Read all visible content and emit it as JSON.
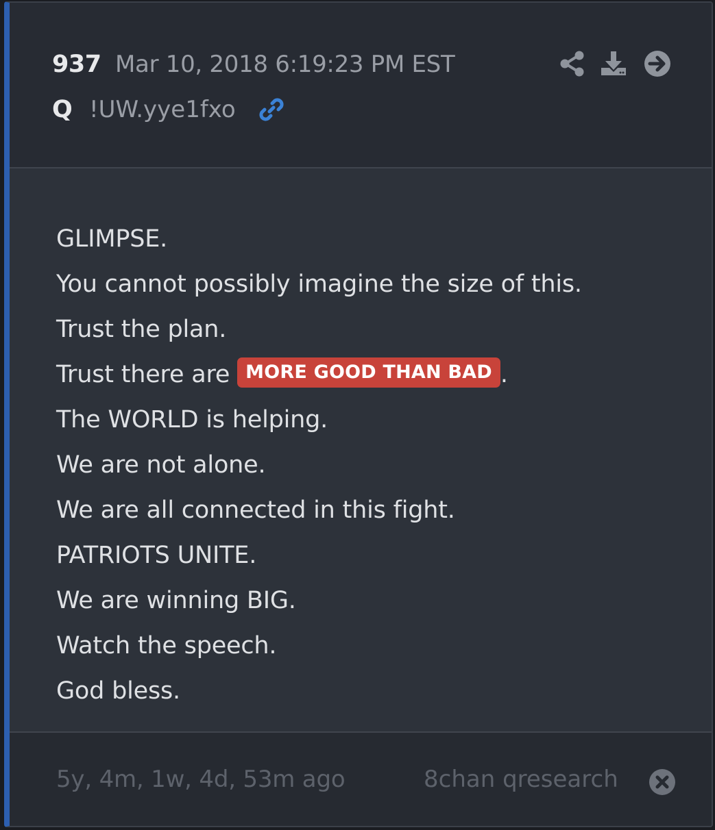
{
  "post": {
    "number": "937",
    "date": "Mar 10, 2018 6:19:23 PM EST",
    "author": "Q",
    "tripcode": "!UW.yye1fxo"
  },
  "header_icons": {
    "share": "share-icon",
    "download": "download-icon",
    "open": "arrow-right-circle-icon",
    "link": "link-icon"
  },
  "body": {
    "lines": [
      "GLIMPSE.",
      "You cannot possibly imagine the size of this.",
      "Trust the plan.",
      "Trust there are ",
      "The WORLD is helping.",
      "We are not alone.",
      "We are all connected in this fight.",
      "PATRIOTS UNITE.",
      "We are winning BIG.",
      "Watch the speech.",
      "God bless."
    ],
    "highlight": "MORE GOOD THAN BAD",
    "highlight_suffix": "."
  },
  "footer": {
    "ago": "5y, 4m, 1w, 4d, 53m ago",
    "source": "8chan qresearch",
    "close": "close-circle-icon"
  },
  "colors": {
    "accent": "#2d5fb0",
    "link": "#3b82d6",
    "highlight": "#c8433a"
  }
}
